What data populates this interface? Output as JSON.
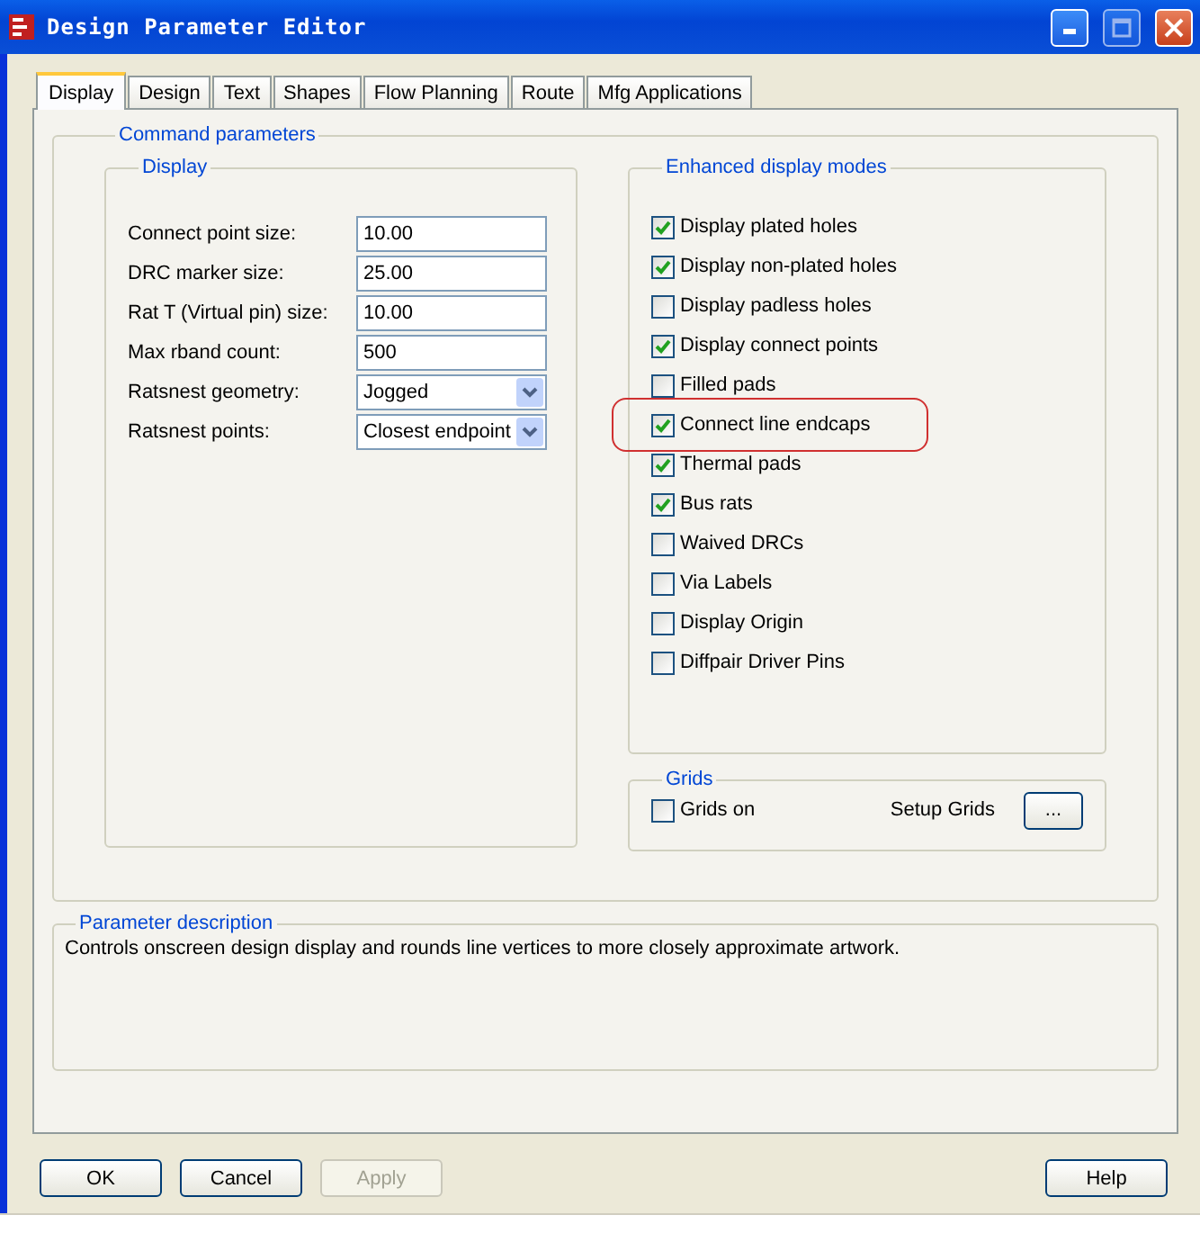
{
  "window": {
    "title": "Design Parameter Editor"
  },
  "tabs": [
    {
      "label": "Display",
      "selected": true
    },
    {
      "label": "Design",
      "selected": false
    },
    {
      "label": "Text",
      "selected": false
    },
    {
      "label": "Shapes",
      "selected": false
    },
    {
      "label": "Flow Planning",
      "selected": false
    },
    {
      "label": "Route",
      "selected": false
    },
    {
      "label": "Mfg Applications",
      "selected": false
    }
  ],
  "command_parameters": {
    "title": "Command parameters",
    "display": {
      "title": "Display",
      "fields": [
        {
          "kind": "text",
          "label": "Connect point size:",
          "value": "10.00"
        },
        {
          "kind": "text",
          "label": "DRC marker size:",
          "value": "25.00"
        },
        {
          "kind": "text",
          "label": "Rat T (Virtual pin) size:",
          "value": "10.00"
        },
        {
          "kind": "text",
          "label": "Max rband count:",
          "value": "500"
        },
        {
          "kind": "dropdown",
          "label": "Ratsnest geometry:",
          "value": "Jogged"
        },
        {
          "kind": "dropdown",
          "label": "Ratsnest points:",
          "value": "Closest endpoint"
        }
      ]
    },
    "enhanced_display_modes": {
      "title": "Enhanced display modes",
      "options": [
        {
          "label": "Display plated holes",
          "checked": true,
          "highlighted": false
        },
        {
          "label": "Display non-plated holes",
          "checked": true,
          "highlighted": false
        },
        {
          "label": "Display padless holes",
          "checked": false,
          "highlighted": false
        },
        {
          "label": "Display connect points",
          "checked": true,
          "highlighted": false
        },
        {
          "label": "Filled pads",
          "checked": false,
          "highlighted": false
        },
        {
          "label": "Connect line endcaps",
          "checked": true,
          "highlighted": true
        },
        {
          "label": "Thermal pads",
          "checked": true,
          "highlighted": false
        },
        {
          "label": "Bus rats",
          "checked": true,
          "highlighted": false
        },
        {
          "label": "Waived DRCs",
          "checked": false,
          "highlighted": false
        },
        {
          "label": "Via Labels",
          "checked": false,
          "highlighted": false
        },
        {
          "label": "Display Origin",
          "checked": false,
          "highlighted": false
        },
        {
          "label": "Diffpair Driver Pins",
          "checked": false,
          "highlighted": false
        }
      ]
    },
    "grids": {
      "title": "Grids",
      "grids_on": {
        "label": "Grids on",
        "checked": false
      },
      "setup_label": "Setup Grids",
      "setup_button": "..."
    }
  },
  "parameter_description": {
    "title": "Parameter description",
    "text": "Controls onscreen design display and rounds line vertices to more closely approximate artwork."
  },
  "buttons": [
    {
      "label": "OK",
      "disabled": false
    },
    {
      "label": "Cancel",
      "disabled": false
    },
    {
      "label": "Apply",
      "disabled": true
    },
    {
      "label": "Help",
      "disabled": false
    }
  ]
}
